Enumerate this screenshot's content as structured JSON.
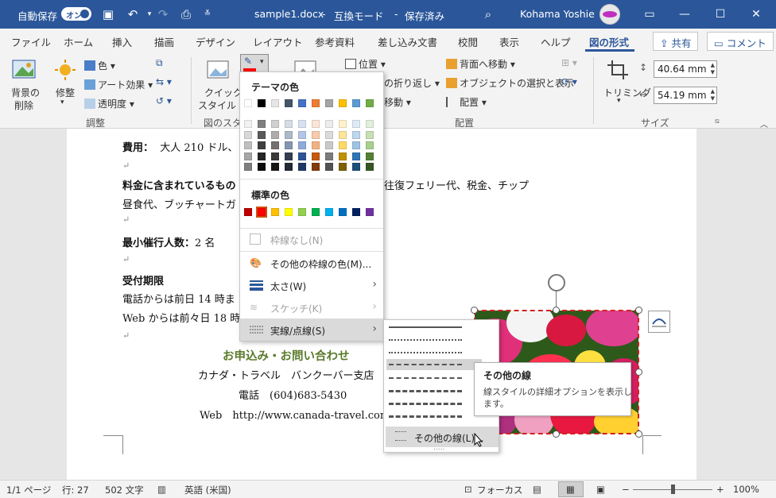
{
  "titlebar": {
    "autosave_label": "自動保存",
    "autosave_state": "オン",
    "doc_title": "sample1.docx",
    "mode": "互換モード",
    "save_state": "保存済み",
    "sep": "-",
    "user": "Kohama Yoshie",
    "minimize": "—",
    "restore": "☐",
    "close": "✕"
  },
  "tabs": [
    {
      "label": "ファイル"
    },
    {
      "label": "ホーム"
    },
    {
      "label": "挿入"
    },
    {
      "label": "描画"
    },
    {
      "label": "デザイン"
    },
    {
      "label": "レイアウト"
    },
    {
      "label": "参考資料"
    },
    {
      "label": "差し込み文書"
    },
    {
      "label": "校閲"
    },
    {
      "label": "表示"
    },
    {
      "label": "ヘルプ"
    },
    {
      "label": "図の形式"
    }
  ],
  "share_label": "共有",
  "comment_label": "コメント",
  "ribbon": {
    "remove_bg": [
      "背景の",
      "削除"
    ],
    "corrections": "修整",
    "color": "色",
    "artistic": "アート効果",
    "transparency": "透明度",
    "adjust_group": "調整",
    "quick_styles": [
      "クイック",
      "スタイル"
    ],
    "styles_group": "図のスタイ",
    "position": "位置",
    "wrap_text": "の折り返し",
    "bring_back": "背面へ移動",
    "selection_pane": "オブジェクトの選択と表示",
    "move_fwd": "移動",
    "align": "配置",
    "arrange_group": "配置",
    "crop": "トリミング",
    "height": "40.64 mm",
    "width": "54.19 mm",
    "size_group": "サイズ"
  },
  "document": {
    "cost_label": "費用：",
    "cost_value": "大人 210 ドル、",
    "included_label": "料金に含まれているもの",
    "included_tail": "往復フェリー代、税金、チップ",
    "included_line2": "昼食代、ブッチャートガ",
    "min_label": "最小催行人数：",
    "min_value": "2 名",
    "deadline_label": "受付期限",
    "deadline_phone": "電話からは前日 14 時ま",
    "deadline_web": "Web からは前々日 18 時",
    "contact_heading": "お申込み・お問い合わせ",
    "agency": "カナダ・トラベル　バンクーバー支店",
    "phone": "電話　(604)683-5430",
    "web": "Web　http://www.canada-travel.com"
  },
  "border_menu": {
    "theme_colors_heading": "テーマの色",
    "standard_colors_heading": "標準の色",
    "no_outline": "枠線なし(N)",
    "more_colors": "その他の枠線の色(M)...",
    "weight": "太さ(W)",
    "sketch": "スケッチ(K)",
    "dashes": "実線/点線(S)",
    "theme_top": [
      "#ffffff",
      "#000000",
      "#e7e6e6",
      "#44546a",
      "#4472c4",
      "#ed7d31",
      "#a5a5a5",
      "#ffc000",
      "#5b9bd5",
      "#70ad47"
    ],
    "theme_shades": [
      [
        "#f2f2f2",
        "#d8d8d8",
        "#bfbfbf",
        "#a5a5a5",
        "#7f7f7f"
      ],
      [
        "#7f7f7f",
        "#595959",
        "#3f3f3f",
        "#262626",
        "#0c0c0c"
      ],
      [
        "#d0cece",
        "#aeabab",
        "#757070",
        "#3a3838",
        "#171616"
      ],
      [
        "#d6dce4",
        "#acb9ca",
        "#8496b0",
        "#333f4f",
        "#222a35"
      ],
      [
        "#d9e2f3",
        "#b4c6e7",
        "#8eaadb",
        "#2f5496",
        "#1f3864"
      ],
      [
        "#fbe5d5",
        "#f7cbac",
        "#f4b183",
        "#c55a11",
        "#833c0b"
      ],
      [
        "#ededed",
        "#dbdbdb",
        "#c9c9c9",
        "#7b7b7b",
        "#525252"
      ],
      [
        "#fff2cc",
        "#fee599",
        "#ffd965",
        "#bf9000",
        "#7f6000"
      ],
      [
        "#deebf6",
        "#bdd7ee",
        "#9cc3e5",
        "#2e75b5",
        "#1e4e79"
      ],
      [
        "#e2efd9",
        "#c5e0b3",
        "#a8d08d",
        "#538135",
        "#375623"
      ]
    ],
    "standard": [
      "#c00000",
      "#ff0000",
      "#ffc000",
      "#ffff00",
      "#92d050",
      "#00b050",
      "#00b0f0",
      "#0070c0",
      "#002060",
      "#7030a0"
    ]
  },
  "dash_submenu": {
    "more_lines": "その他の線(L)...",
    "grip": "....."
  },
  "tooltip": {
    "title": "その他の線",
    "body_line1": "線スタイルの詳細オプションを表示し",
    "body_line2": "ます。"
  },
  "status": {
    "page": "1/1 ページ",
    "line": "行: 27",
    "chars": "502 文字",
    "lang": "英語 (米国)",
    "focus": "フォーカス",
    "zoom": "100%",
    "minus": "−",
    "plus": "+"
  },
  "colors": {
    "accent": "#2b579a",
    "outline_red": "#d02020",
    "heading_green": "#5a7a2a"
  }
}
